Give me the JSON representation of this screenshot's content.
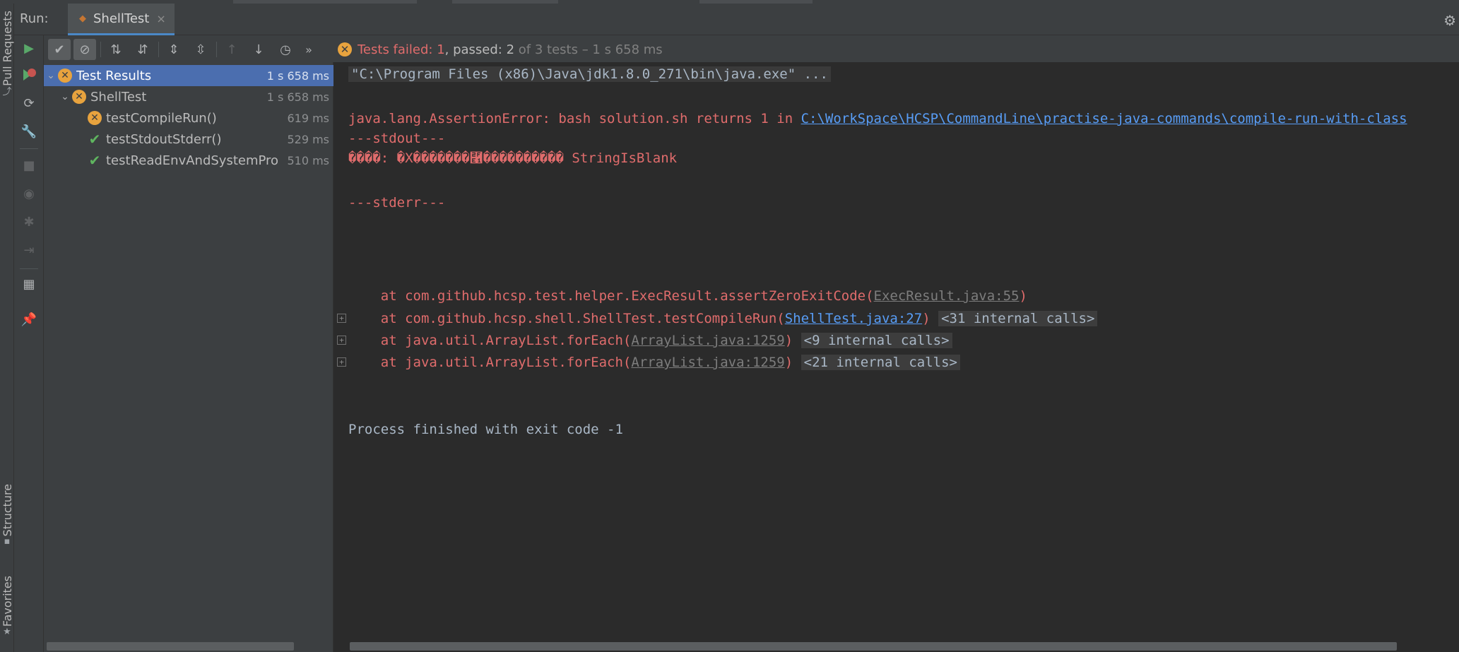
{
  "left_strip": {
    "tab_pull_requests": "Pull Requests",
    "tab_structure": "Structure",
    "tab_favorites": "Favorites"
  },
  "run_window": {
    "label": "Run:",
    "tab_title": "ShellTest",
    "tab_close": "×"
  },
  "toolbar": {
    "status": {
      "failed_prefix": "Tests failed: ",
      "failed_count": "1",
      "passed_prefix": ", passed: ",
      "passed_count": "2",
      "rest": " of 3 tests – 1 s 658 ms"
    }
  },
  "tree": {
    "rows": [
      {
        "name": "Test Results",
        "time": "1 s 658 ms",
        "status": "failed"
      },
      {
        "name": "ShellTest",
        "time": "1 s 658 ms",
        "status": "failed"
      },
      {
        "name": "testCompileRun()",
        "time": "619 ms",
        "status": "failed"
      },
      {
        "name": "testStdoutStderr()",
        "time": "529 ms",
        "status": "passed"
      },
      {
        "name": "testReadEnvAndSystemPro",
        "time": "510 ms",
        "status": "passed"
      }
    ]
  },
  "console": {
    "cmd_line": "\"C:\\Program Files (x86)\\Java\\jdk1.8.0_271\\bin\\java.exe\" ...",
    "error_prefix": "java.lang.AssertionError: bash solution.sh returns 1 in ",
    "error_path": "C:\\WorkSpace\\HCSP\\CommandLine\\practise-java-commands\\compile-run-with-class",
    "stdout_marker": "---stdout---",
    "garbled_line": "����: �X�������⿡���������� StringIsBlank",
    "stderr_marker": "---stderr---",
    "stack": [
      {
        "prefix": "    at com.github.hcsp.test.helper.ExecResult.assertZeroExitCode(",
        "link": "ExecResult.java:55",
        "suffix": ")",
        "internal": "",
        "link_style": "gray"
      },
      {
        "prefix": "    at com.github.hcsp.shell.ShellTest.testCompileRun(",
        "link": "ShellTest.java:27",
        "suffix": ")",
        "internal": "<31 internal calls>",
        "link_style": "blue"
      },
      {
        "prefix": "    at java.util.ArrayList.forEach(",
        "link": "ArrayList.java:1259",
        "suffix": ")",
        "internal": "<9 internal calls>",
        "link_style": "gray"
      },
      {
        "prefix": "    at java.util.ArrayList.forEach(",
        "link": "ArrayList.java:1259",
        "suffix": ")",
        "internal": "<21 internal calls>",
        "link_style": "gray"
      }
    ],
    "fold_glyph": "+",
    "exit_line": "Process finished with exit code -1"
  },
  "colors": {
    "failed": "#e06c6c",
    "warn_badge": "#e8a33e",
    "passed_check": "#5fb55f",
    "selection": "#4b6eaf",
    "link": "#589df6"
  }
}
